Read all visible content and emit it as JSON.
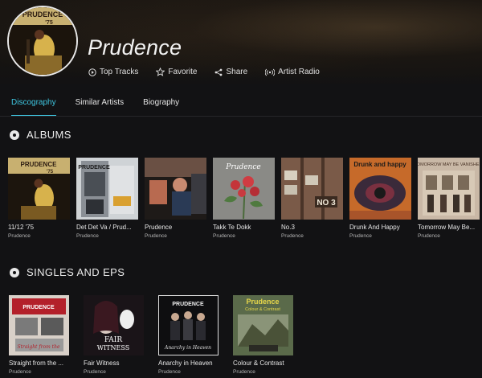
{
  "artist": {
    "name": "Prudence"
  },
  "actions": [
    {
      "label": "Top Tracks",
      "icon": "play-circle-icon"
    },
    {
      "label": "Favorite",
      "icon": "star-icon"
    },
    {
      "label": "Share",
      "icon": "share-icon"
    },
    {
      "label": "Artist Radio",
      "icon": "radio-icon"
    }
  ],
  "tabs": [
    {
      "label": "Discography",
      "active": true
    },
    {
      "label": "Similar Artists",
      "active": false
    },
    {
      "label": "Biography",
      "active": false
    }
  ],
  "accent_color": "#3fc6e0",
  "albums": {
    "title": "ALBUMS",
    "items": [
      {
        "title": "11/12 '75",
        "artist": "Prudence"
      },
      {
        "title": "Det Det Va / Prud...",
        "artist": "Prudence"
      },
      {
        "title": "Prudence",
        "artist": "Prudence"
      },
      {
        "title": "Takk Te Dokk",
        "artist": "Prudence"
      },
      {
        "title": "No.3",
        "artist": "Prudence"
      },
      {
        "title": "Drunk And Happy",
        "artist": "Prudence"
      },
      {
        "title": "Tomorrow May Be...",
        "artist": "Prudence"
      }
    ]
  },
  "singles": {
    "title": "SINGLES AND EPS",
    "items": [
      {
        "title": "Straight from the ...",
        "artist": "Prudence"
      },
      {
        "title": "Fair Witness",
        "artist": "Prudence"
      },
      {
        "title": "Anarchy in Heaven",
        "artist": "Prudence"
      },
      {
        "title": "Colour & Contrast",
        "artist": "Prudence"
      }
    ]
  }
}
